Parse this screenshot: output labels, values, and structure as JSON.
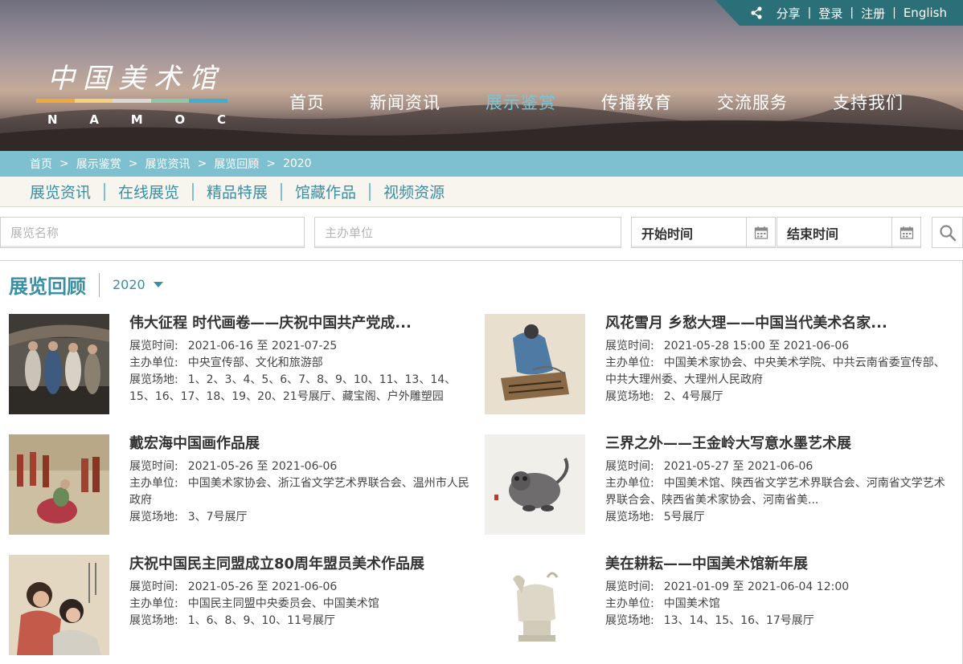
{
  "top_links": {
    "share_icon": "share-icon",
    "items": [
      "分享",
      "登录",
      "注册",
      "English"
    ]
  },
  "logo": {
    "cn": "中国美术馆",
    "en": [
      "N",
      "A",
      "M",
      "O",
      "C"
    ],
    "bar_colors": [
      "#f2a93b",
      "#f7d07a",
      "#d9d9d9",
      "#8cc9a8",
      "#3ab0d8"
    ]
  },
  "main_nav": {
    "items": [
      "首页",
      "新闻资讯",
      "展示鉴赏",
      "传播教育",
      "交流服务",
      "支持我们"
    ],
    "active": "展示鉴赏"
  },
  "breadcrumb": [
    "首页",
    "展示鉴赏",
    "展览资讯",
    "展览回顾",
    "2020"
  ],
  "breadcrumb_sep": ">",
  "subnav": [
    "展览资讯",
    "在线展览",
    "精品特展",
    "馆藏作品",
    "视频资源"
  ],
  "filters": {
    "name_placeholder": "展览名称",
    "org_placeholder": "主办单位",
    "start_label": "开始时间",
    "end_label": "结束时间",
    "calendar_icon": "calendar-icon",
    "search_icon": "search-icon"
  },
  "section": {
    "title": "展览回顾",
    "year": "2020"
  },
  "labels": {
    "time": "展览时间:",
    "org": "主办单位:",
    "venue": "展览场地:"
  },
  "exhibitions": [
    {
      "title": "伟大征程 时代画卷——庆祝中国共产党成...",
      "time": "2021-06-16 至 2021-07-25",
      "org": "中央宣传部、文化和旅游部",
      "venue": "1、2、3、4、5、6、7、8、9、10、11、13、14、15、16、17、18、19、20、21号展厅、藏宝阁、户外雕塑园"
    },
    {
      "title": "风花雪月 乡愁大理——中国当代美术名家...",
      "time": "2021-05-28 15:00 至 2021-06-06",
      "org": "中国美术家协会、中央美术学院、中共云南省委宣传部、中共大理州委、大理州人民政府",
      "venue": "2、4号展厅"
    },
    {
      "title": "戴宏海中国画作品展",
      "time": "2021-05-26 至 2021-06-06",
      "org": "中国美术家协会、浙江省文学艺术界联合会、温州市人民政府",
      "venue": "3、7号展厅"
    },
    {
      "title": "三界之外——王金岭大写意水墨艺术展",
      "time": "2021-05-27 至 2021-06-06",
      "org": "中国美术馆、陕西省文学艺术界联合会、河南省文学艺术界联合会、陕西省美术家协会、河南省美...",
      "venue": "5号展厅"
    },
    {
      "title": "庆祝中国民主同盟成立80周年盟员美术作品展",
      "time": "2021-05-26 至 2021-06-06",
      "org": "中国民主同盟中央委员会、中国美术馆",
      "venue": "1、6、8、9、10、11号展厅"
    },
    {
      "title": "美在耕耘——中国美术馆新年展",
      "time": "2021-01-09 至 2021-06-04 12:00",
      "org": "中国美术馆",
      "venue": "13、14、15、16、17号展厅"
    }
  ]
}
